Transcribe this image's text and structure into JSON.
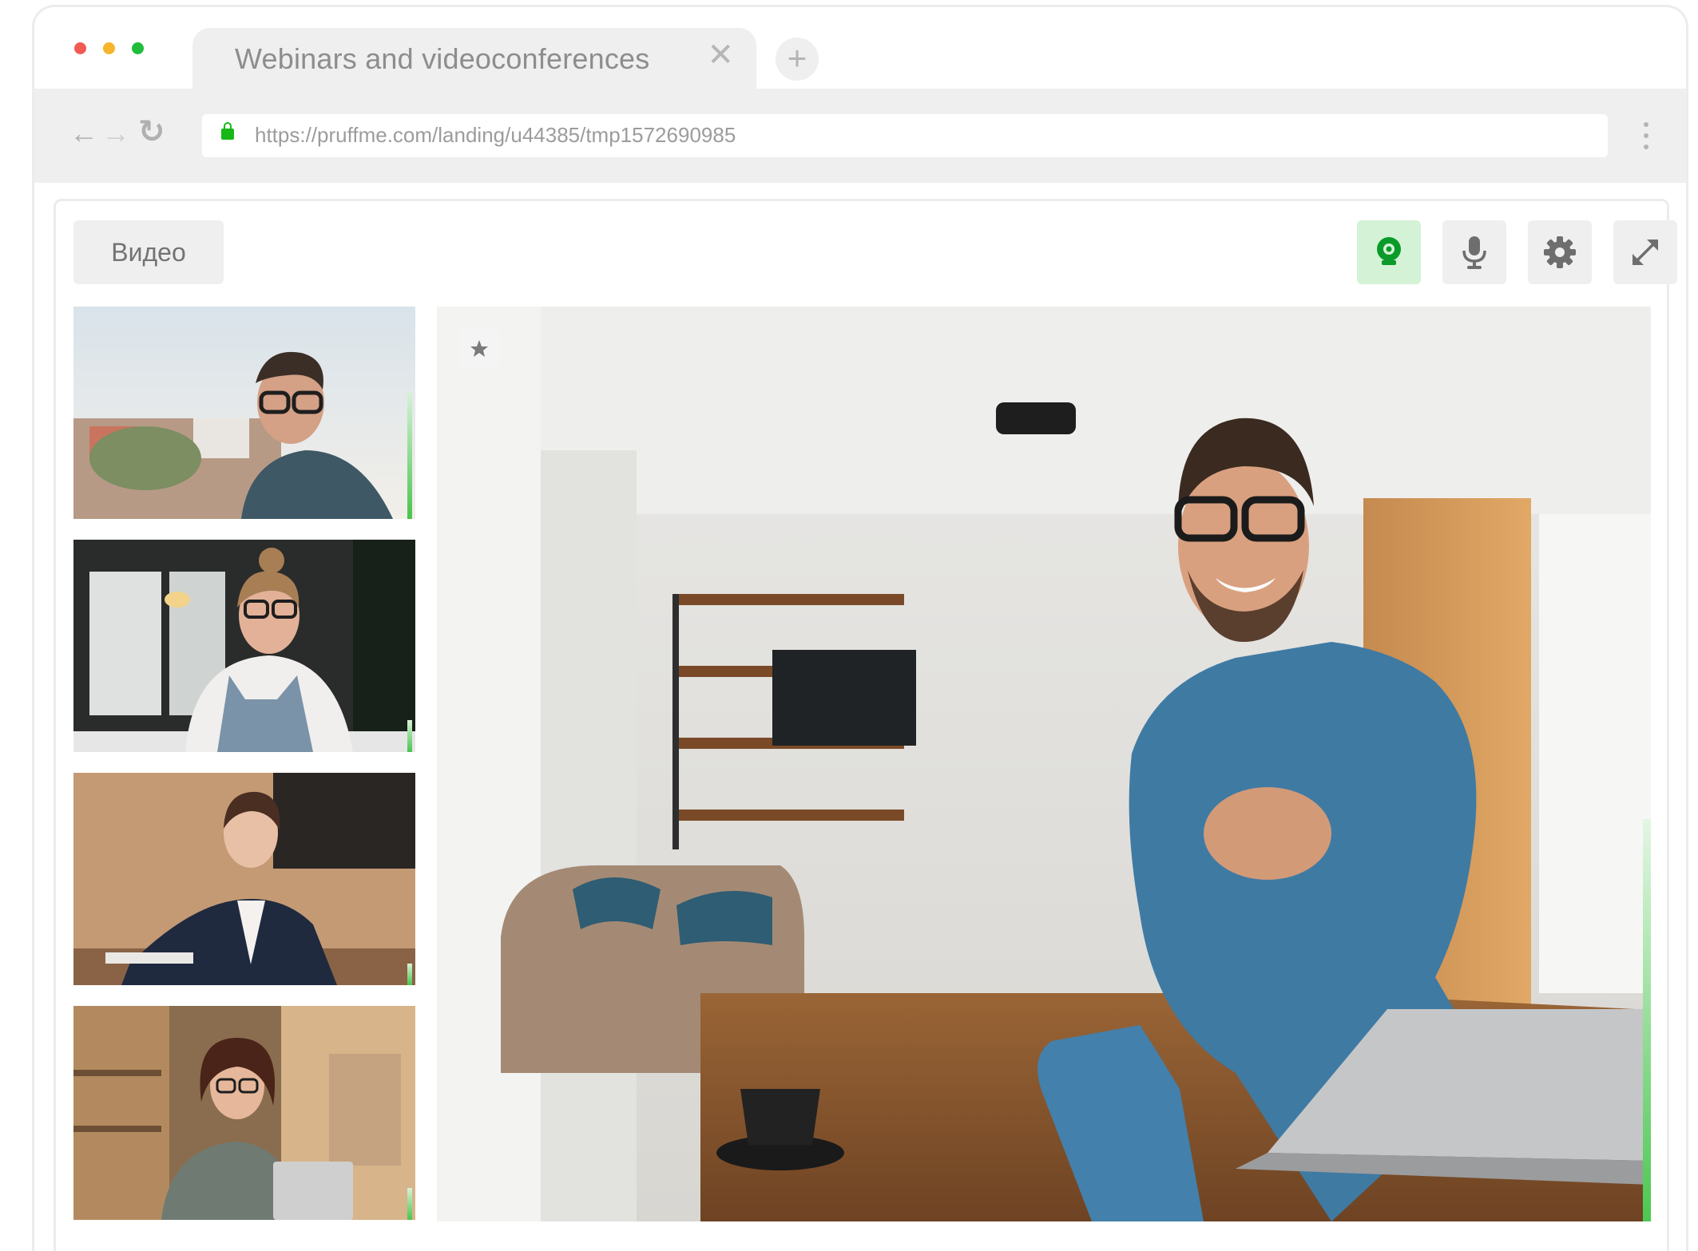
{
  "window": {
    "traffic_lights": [
      "#f05a52",
      "#f6b52a",
      "#1fbd3a"
    ],
    "tab_title": "Webinars and videoconferences",
    "tab_close": "✕",
    "new_tab": "+"
  },
  "toolbar": {
    "back": "←",
    "forward": "→",
    "reload": "↻",
    "url": "https://pruffme.com/landing/u44385/tmp1572690985",
    "lock_color": "#16b816"
  },
  "conference": {
    "view_tab": "Видео",
    "controls": [
      {
        "name": "webcam",
        "icon": "webcam-icon",
        "active": true,
        "color": "#0a9b2a"
      },
      {
        "name": "microphone",
        "icon": "microphone-icon",
        "active": false
      },
      {
        "name": "settings",
        "icon": "gear-icon",
        "active": false
      },
      {
        "name": "fullscreen",
        "icon": "expand-icon",
        "active": false
      }
    ],
    "participants": [
      {
        "description": "man-with-glasses-outdoors",
        "audio_level": 0.6
      },
      {
        "description": "woman-with-glasses-at-desk",
        "audio_level": 0.15
      },
      {
        "description": "woman-in-blazer-at-desk",
        "audio_level": 0.1
      },
      {
        "description": "woman-with-laptop-in-cafe",
        "audio_level": 0.15
      }
    ],
    "speaker": {
      "description": "smiling-man-with-laptop",
      "pinned_icon": "star-icon",
      "audio_level": 0.44
    },
    "accent_color": "#49c44e"
  }
}
